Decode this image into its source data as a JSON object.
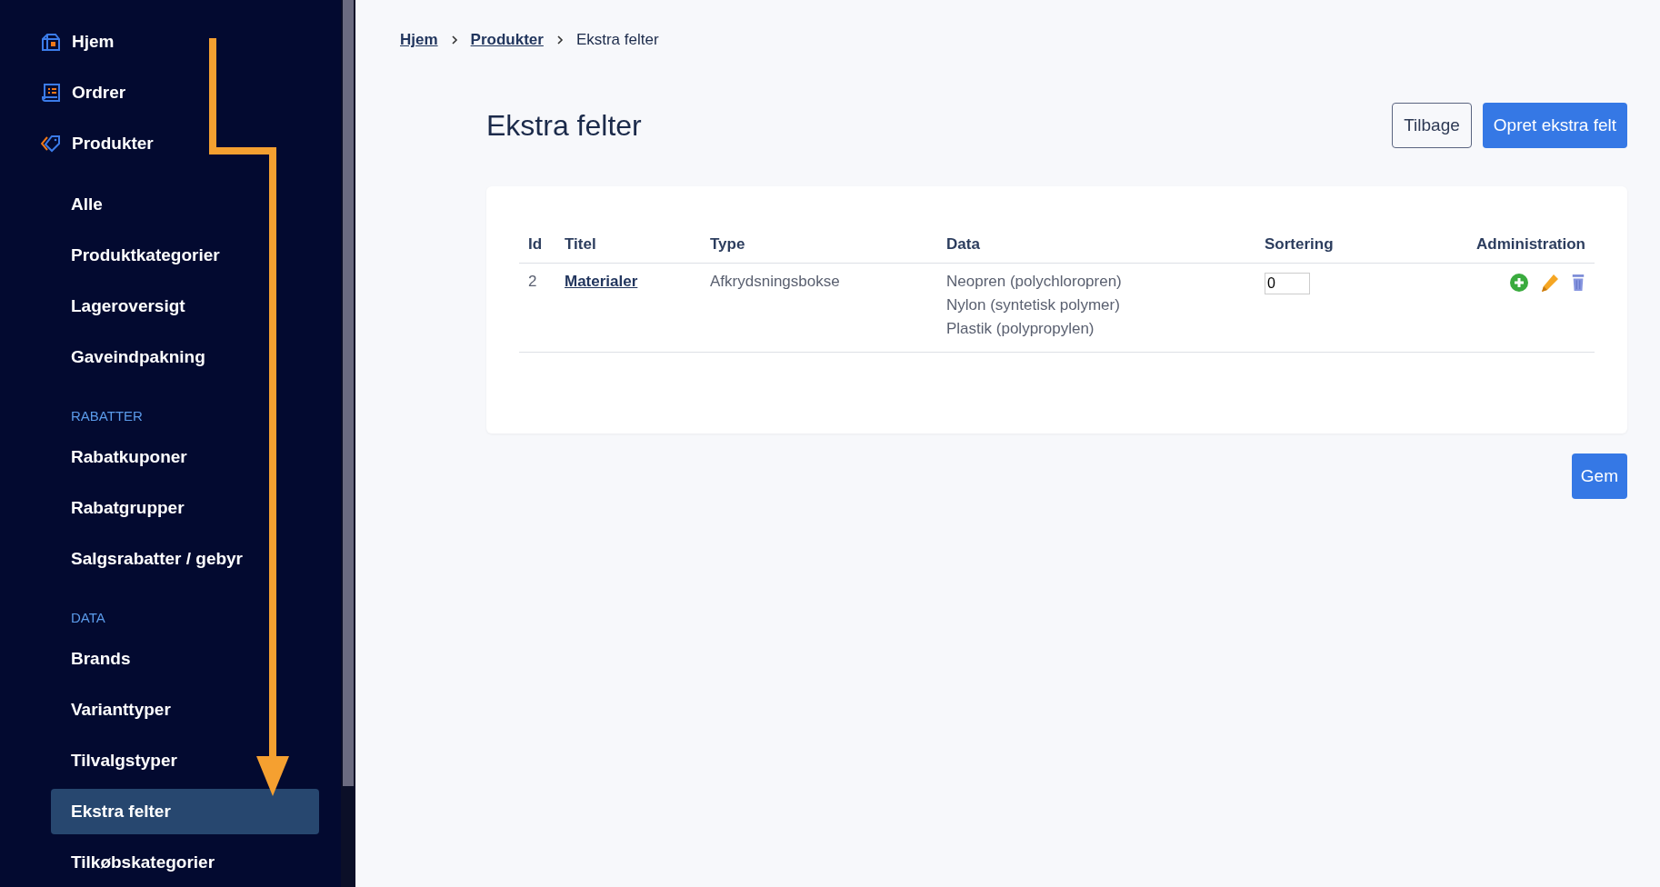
{
  "sidebar": {
    "items": [
      {
        "kind": "main",
        "label": "Hjem",
        "selected": false
      },
      {
        "kind": "main",
        "label": "Ordrer",
        "selected": false
      },
      {
        "kind": "main",
        "label": "Produkter",
        "selected": false
      },
      {
        "kind": "sub",
        "label": "Alle",
        "selected": false
      },
      {
        "kind": "sub",
        "label": "Produktkategorier",
        "selected": false
      },
      {
        "kind": "sub",
        "label": "Lageroversigt",
        "selected": false
      },
      {
        "kind": "sub",
        "label": "Gaveindpakning",
        "selected": false
      },
      {
        "kind": "section",
        "label": "RABATTER"
      },
      {
        "kind": "sub",
        "label": "Rabatkuponer",
        "selected": false
      },
      {
        "kind": "sub",
        "label": "Rabatgrupper",
        "selected": false
      },
      {
        "kind": "sub",
        "label": "Salgsrabatter / gebyr",
        "selected": false
      },
      {
        "kind": "section",
        "label": "DATA"
      },
      {
        "kind": "sub",
        "label": "Brands",
        "selected": false
      },
      {
        "kind": "sub",
        "label": "Varianttyper",
        "selected": false
      },
      {
        "kind": "sub",
        "label": "Tilvalgstyper",
        "selected": false
      },
      {
        "kind": "sub",
        "label": "Ekstra felter",
        "selected": true
      },
      {
        "kind": "sub",
        "label": "Tilkøbskategorier",
        "selected": false
      }
    ]
  },
  "breadcrumb": [
    {
      "label": "Hjem",
      "link": true
    },
    {
      "label": "Produkter",
      "link": true
    },
    {
      "label": "Ekstra felter",
      "link": false
    }
  ],
  "page_title": "Ekstra felter",
  "header_buttons": [
    {
      "label": "Tilbage",
      "kind": "outline"
    },
    {
      "label": "Opret ekstra felt",
      "kind": "primary"
    }
  ],
  "table": {
    "columns": [
      "Id",
      "Titel",
      "Type",
      "Data",
      "Sortering",
      "Administration"
    ],
    "rows": [
      {
        "id": "2",
        "title": "Materialer",
        "type": "Afkrydsningsbokse",
        "data": [
          "Neopren (polychloropren)",
          "Nylon (syntetisk polymer)",
          "Plastik (polypropylen)"
        ],
        "sorting": "0"
      }
    ]
  },
  "save_button": "Gem"
}
